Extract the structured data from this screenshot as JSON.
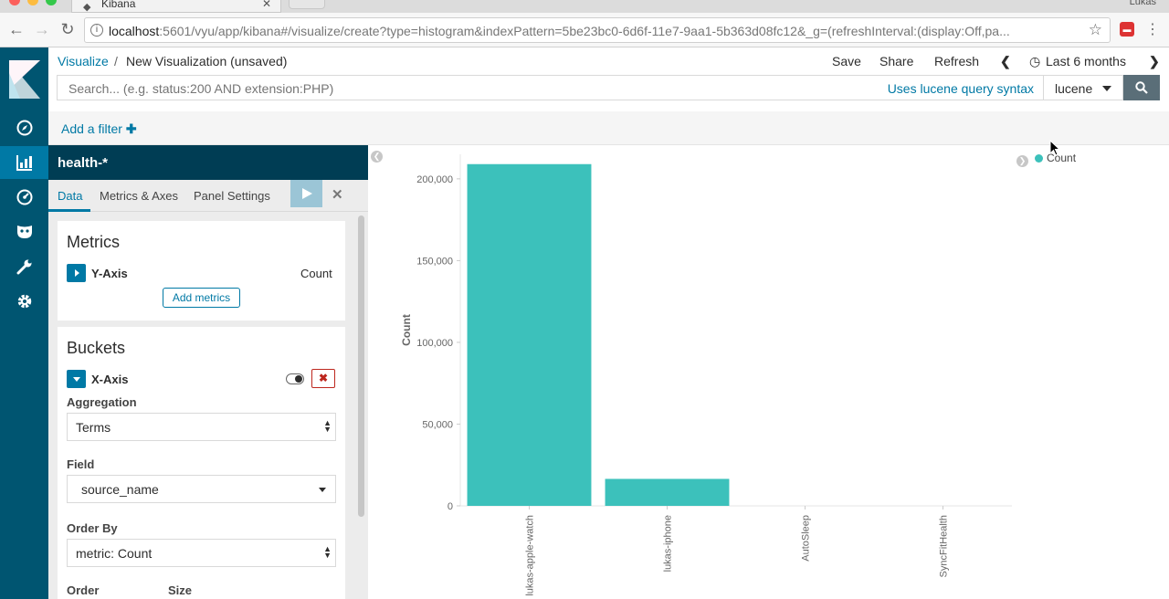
{
  "browser": {
    "tab_title": "Kibana",
    "user": "Lukas",
    "url_host": "localhost",
    "url_rest": ":5601/vyu/app/kibana#/visualize/create?type=histogram&indexPattern=5be23bc0-6d6f-11e7-9aa1-5b363d08fc12&_g=(refreshInterval:(display:Off,pa..."
  },
  "topbar": {
    "breadcrumb_root": "Visualize",
    "breadcrumb_sep": "/",
    "breadcrumb_current": "New Visualization (unsaved)",
    "save": "Save",
    "share": "Share",
    "refresh": "Refresh",
    "time_range": "Last 6 months"
  },
  "search": {
    "placeholder": "Search... (e.g. status:200 AND extension:PHP)",
    "syntax_link": "Uses lucene query syntax",
    "language": "lucene"
  },
  "filter": {
    "add_label": "Add a filter"
  },
  "editor": {
    "index_pattern": "health-*",
    "tabs": [
      "Data",
      "Metrics & Axes",
      "Panel Settings"
    ],
    "metrics": {
      "title": "Metrics",
      "y_axis_label": "Y-Axis",
      "y_axis_value": "Count",
      "add_button": "Add metrics"
    },
    "buckets": {
      "title": "Buckets",
      "x_axis_label": "X-Axis",
      "aggregation_label": "Aggregation",
      "aggregation_value": "Terms",
      "field_label": "Field",
      "field_value": "source_name",
      "order_by_label": "Order By",
      "order_by_value": "metric: Count",
      "order_label": "Order",
      "size_label": "Size"
    }
  },
  "colors": {
    "bar": "#3cc1bb",
    "accent": "#0079a5",
    "nav": "#005571"
  },
  "chart_data": {
    "type": "bar",
    "categories": [
      "lukas-apple-watch",
      "lukas-iphone",
      "AutoSleep",
      "SyncFitHealth"
    ],
    "values": [
      209000,
      16500,
      0,
      0
    ],
    "ylabel": "Count",
    "yticks": [
      0,
      50000,
      100000,
      150000,
      200000
    ],
    "ytick_labels": [
      "0",
      "50,000",
      "100,000",
      "150,000",
      "200,000"
    ],
    "ylim": [
      0,
      215000
    ],
    "legend": [
      "Count"
    ],
    "legend_position": "top-right",
    "grid": false
  }
}
